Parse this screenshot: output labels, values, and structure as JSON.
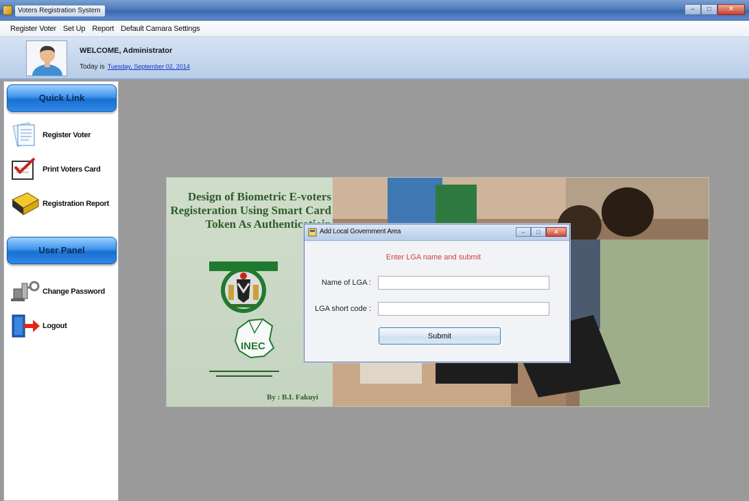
{
  "window": {
    "title": "Voters Registration System",
    "controls": [
      "–",
      "□",
      "✕"
    ]
  },
  "menu": [
    "Register Voter",
    "Set Up",
    "Report",
    "Default Camara Settings"
  ],
  "header": {
    "welcome": "WELCOME, Administrator",
    "today_label": "Today is",
    "date": "Tuesday, September 02, 2014"
  },
  "sidebar": {
    "quick_link": "Quick Link",
    "quick_items": [
      "Register Voter",
      "Print Voters Card",
      "Registration Report"
    ],
    "user_panel": "User Panel",
    "user_items": [
      "Change Password",
      "Logout"
    ]
  },
  "banner": {
    "title": "Design of Biometric E-voters Registeration Using Smart Card Token As Authenticatioin",
    "logo_text": "INEC",
    "author": "By : B.I. Fakuyi"
  },
  "dialog": {
    "title": "Add Local Government Area",
    "instruction": "Enter LGA name and submit",
    "name_label": "Name of LGA :",
    "code_label": "LGA short code :",
    "name_value": "",
    "code_value": "",
    "submit": "Submit",
    "controls": [
      "–",
      "□",
      "✕"
    ]
  },
  "colors": {
    "titlebar": "#4f7cc0",
    "panel_button": "#2f88ea",
    "link": "#1633c8",
    "instruction": "#d04040"
  }
}
